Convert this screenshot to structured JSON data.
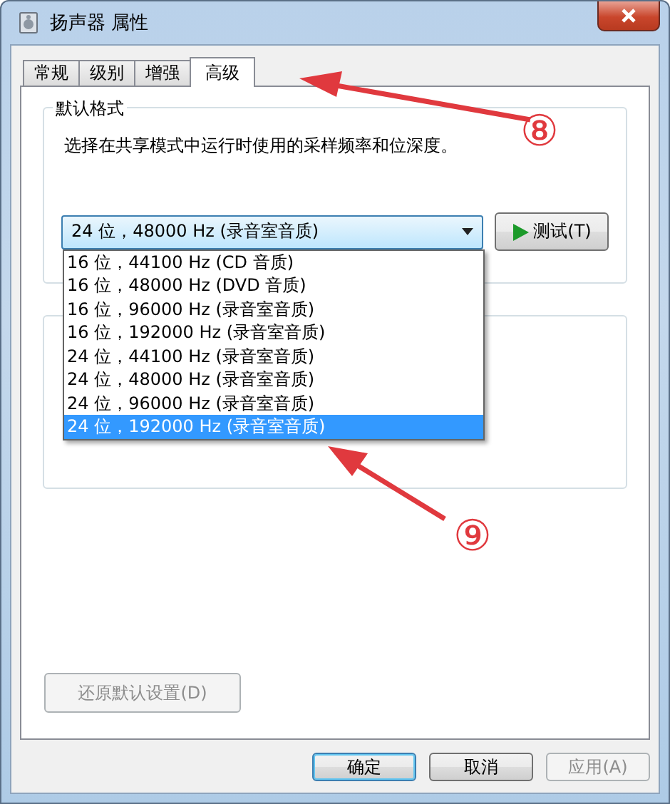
{
  "window": {
    "title": "扬声器 属性"
  },
  "tabs": [
    {
      "label": "常规",
      "selected": false
    },
    {
      "label": "级别",
      "selected": false
    },
    {
      "label": "增强",
      "selected": false
    },
    {
      "label": "高级",
      "selected": true
    }
  ],
  "default_format": {
    "title": "默认格式",
    "description": "选择在共享模式中运行时使用的采样频率和位深度。",
    "combo": {
      "value": "24 位，48000 Hz (录音室音质)",
      "expanded": true
    },
    "test_button": "测试(T)",
    "options": [
      {
        "label": "16 位，44100 Hz (CD 音质)",
        "selected": false
      },
      {
        "label": "16 位，48000 Hz (DVD 音质)",
        "selected": false
      },
      {
        "label": "16 位，96000 Hz (录音室音质)",
        "selected": false
      },
      {
        "label": "16 位，192000 Hz (录音室音质)",
        "selected": false
      },
      {
        "label": "24 位，44100 Hz (录音室音质)",
        "selected": false
      },
      {
        "label": "24 位，48000 Hz (录音室音质)",
        "selected": false
      },
      {
        "label": "24 位，96000 Hz (录音室音质)",
        "selected": false
      },
      {
        "label": "24 位，192000 Hz (录音室音质)",
        "selected": true
      }
    ]
  },
  "restore_button": {
    "label": "还原默认设置(D)",
    "disabled": true
  },
  "buttons": [
    {
      "label": "确定",
      "kind": "default",
      "disabled": false
    },
    {
      "label": "取消",
      "kind": "normal",
      "disabled": false
    },
    {
      "label": "应用(A)",
      "kind": "normal",
      "disabled": true
    }
  ],
  "annotations": [
    {
      "label": "⑧"
    },
    {
      "label": "⑨"
    }
  ]
}
